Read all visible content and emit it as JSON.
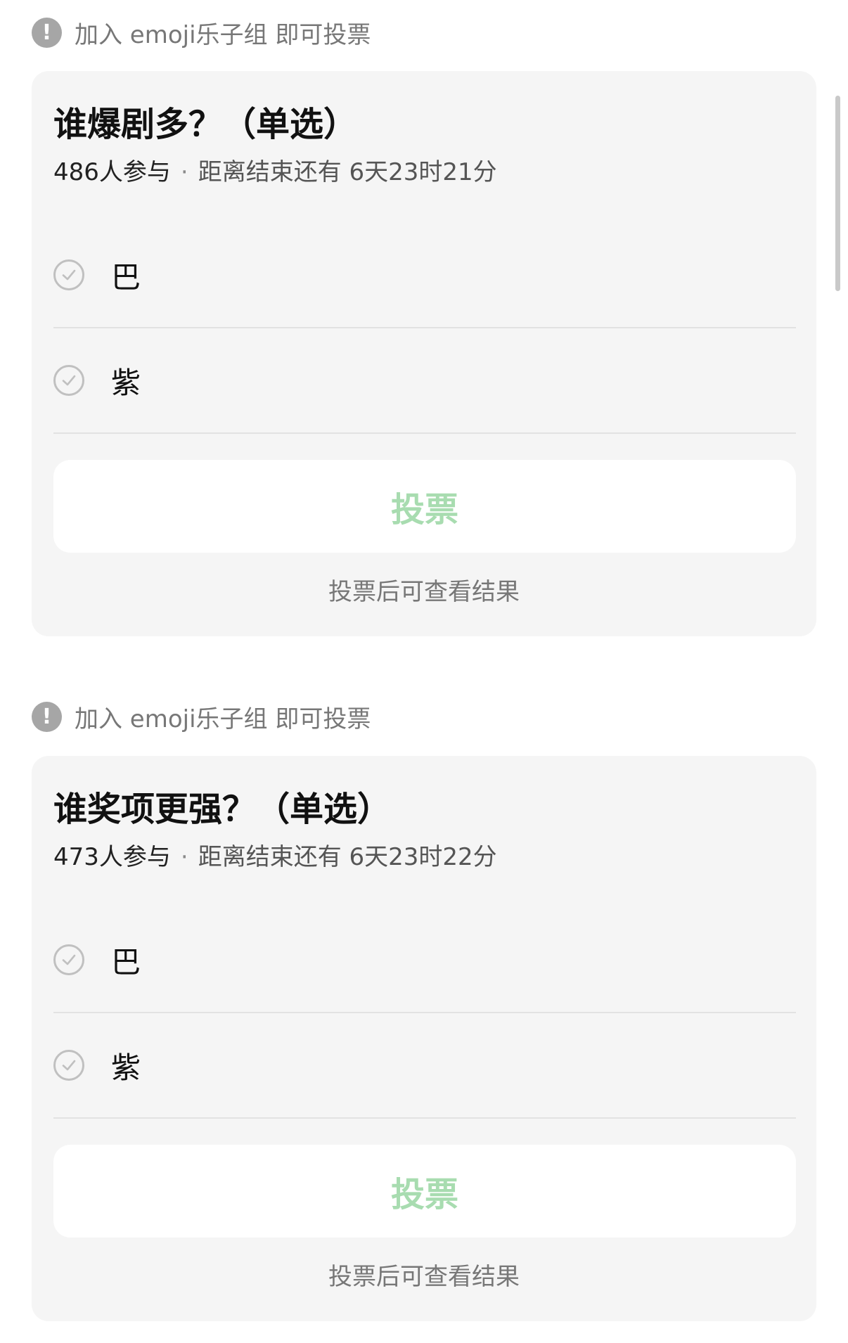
{
  "colors": {
    "page_background": "#ffffff",
    "card_background": "#f5f5f5",
    "vote_button_text": "#a8dcb0",
    "notice_icon": "#a6a6a6"
  },
  "polls": [
    {
      "notice": {
        "icon": "exclamation-circle-icon",
        "text": "加入 emoji乐子组 即可投票"
      },
      "title": "谁爆剧多？（单选）",
      "participants": "486人参与",
      "separator": "·",
      "time_remaining": "距离结束还有 6天23时21分",
      "options": [
        {
          "label": "巴",
          "icon": "check-circle-icon"
        },
        {
          "label": "紫",
          "icon": "check-circle-icon"
        }
      ],
      "vote_button_label": "投票",
      "result_hint": "投票后可查看结果"
    },
    {
      "notice": {
        "icon": "exclamation-circle-icon",
        "text": "加入 emoji乐子组 即可投票"
      },
      "title": "谁奖项更强？（单选）",
      "participants": "473人参与",
      "separator": "·",
      "time_remaining": "距离结束还有 6天23时22分",
      "options": [
        {
          "label": "巴",
          "icon": "check-circle-icon"
        },
        {
          "label": "紫",
          "icon": "check-circle-icon"
        }
      ],
      "vote_button_label": "投票",
      "result_hint": "投票后可查看结果"
    }
  ]
}
